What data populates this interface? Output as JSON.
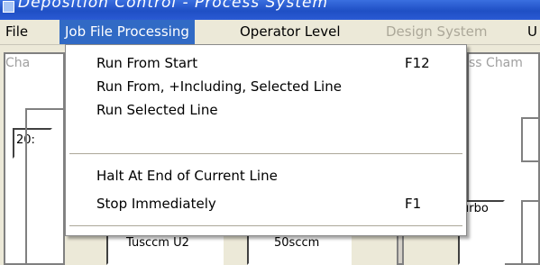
{
  "window": {
    "title": "Deposition Control - Process System"
  },
  "menubar": {
    "items": [
      {
        "label": "File"
      },
      {
        "label": "Job File Processing"
      },
      {
        "label": "Operator Level"
      },
      {
        "label": "Design System"
      },
      {
        "label": "U"
      }
    ]
  },
  "dropdown": {
    "items": [
      {
        "label": "Run From Start",
        "shortcut": "F12"
      },
      {
        "label": "Run From, +Including, Selected Line",
        "shortcut": ""
      },
      {
        "label": "Run Selected Line",
        "shortcut": ""
      },
      {
        "label": "Halt At End of Current Line",
        "shortcut": ""
      },
      {
        "label": "Stop Immediately",
        "shortcut": "F1"
      }
    ]
  },
  "background": {
    "panel_left_label": "Cha",
    "panel_right_label": "ss Cham",
    "field_left": "20:",
    "turbo_label": "urbo",
    "gauge_1": "Tusccm U2",
    "gauge_2": "50sccm"
  },
  "colors": {
    "highlight": "#316ac5",
    "menubar_bg": "#ece9d8",
    "disabled_text": "#aca899"
  }
}
